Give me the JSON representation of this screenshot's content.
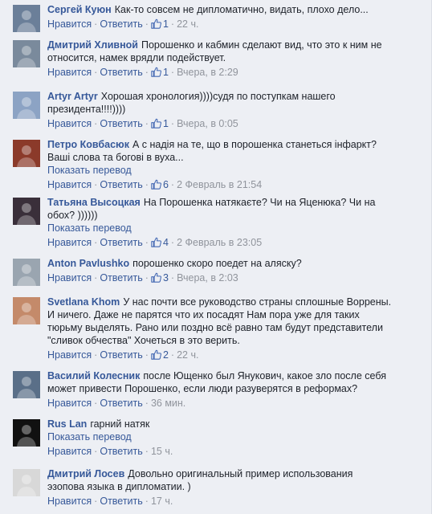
{
  "comments": [
    {
      "author": "Сергей Куюн",
      "lines": [
        "Как-то совсем не дипломатично, видать, плохо дело..."
      ],
      "translate": "",
      "reply": "Нравится",
      "answer": "Ответить",
      "likes": "1",
      "time": "22 ч.",
      "avatar_color": "#6b7f99"
    },
    {
      "author": "Дмитрий Хливной",
      "lines": [
        "Порошенко и кабмин сделают вид, что это к ним не",
        "относится, намек врядли подействует."
      ],
      "translate": "",
      "reply": "Нравится",
      "answer": "Ответить",
      "likes": "1",
      "time": "Вчера, в 2:29",
      "avatar_color": "#7a8a9c"
    },
    {
      "author": "Artyr Artyr",
      "lines": [
        "Хорошая хронология))))судя по поступкам нашего",
        "президента!!!!))))"
      ],
      "translate": "",
      "reply": "Нравится",
      "answer": "Ответить",
      "likes": "1",
      "time": "Вчера, в 0:05",
      "avatar_color": "#8ca3c4"
    },
    {
      "author": "Петро Ковбасюк",
      "lines": [
        "А с надія на те, що в порошенка станеться інфаркт?",
        "Ваші слова та богові в вуха..."
      ],
      "translate": "Показать перевод",
      "reply": "Нравится",
      "answer": "Ответить",
      "likes": "6",
      "time": "2 Февраль в 21:54",
      "avatar_color": "#8b3a2a"
    },
    {
      "author": "Татьяна Высоцкая",
      "lines": [
        "На Порошенка натякаєте? Чи на Яценюка? Чи на",
        "обох? ))))))"
      ],
      "translate": "Показать перевод",
      "reply": "Нравится",
      "answer": "Ответить",
      "likes": "4",
      "time": "2 Февраль в 23:05",
      "avatar_color": "#3a2f3a"
    },
    {
      "author": "Anton Pavlushko",
      "lines": [
        "порошенко скоро поедет на аляску?"
      ],
      "translate": "",
      "reply": "Нравится",
      "answer": "Ответить",
      "likes": "3",
      "time": "Вчера, в 2:03",
      "avatar_color": "#9aa5b0"
    },
    {
      "author": "Svetlana Khom",
      "lines": [
        "У нас почти все руководство страны сплошные Воррены.",
        "И ничего. Даже не парятся что их посадят Нам пора уже для таких",
        "тюрьму выделять. Рано или поздно всё равно там будут представители",
        "\"сливок обчества\" Хочеться в это верить."
      ],
      "translate": "",
      "reply": "Нравится",
      "answer": "Ответить",
      "likes": "2",
      "time": "22 ч.",
      "avatar_color": "#c48a6a"
    },
    {
      "author": "Василий Колесник",
      "lines": [
        "после Ющенко был Янукович, какое зло после себя",
        "может привести Порошенко, если люди разуверятся в реформах?"
      ],
      "translate": "",
      "reply": "Нравится",
      "answer": "Ответить",
      "likes": "",
      "time": "36 мин.",
      "avatar_color": "#5a6f88"
    },
    {
      "author": "Rus Lan",
      "lines": [
        "гарний натяк"
      ],
      "translate": "Показать перевод",
      "reply": "Нравится",
      "answer": "Ответить",
      "likes": "",
      "time": "15 ч.",
      "avatar_color": "#111111"
    },
    {
      "author": "Дмитрий Лосев",
      "lines": [
        "Довольно оригинальный пример использования",
        "эзопова языка в дипломатии. )"
      ],
      "translate": "",
      "reply": "Нравится",
      "answer": "Ответить",
      "likes": "",
      "time": "17 ч.",
      "avatar_color": "#d8d8d8"
    }
  ]
}
